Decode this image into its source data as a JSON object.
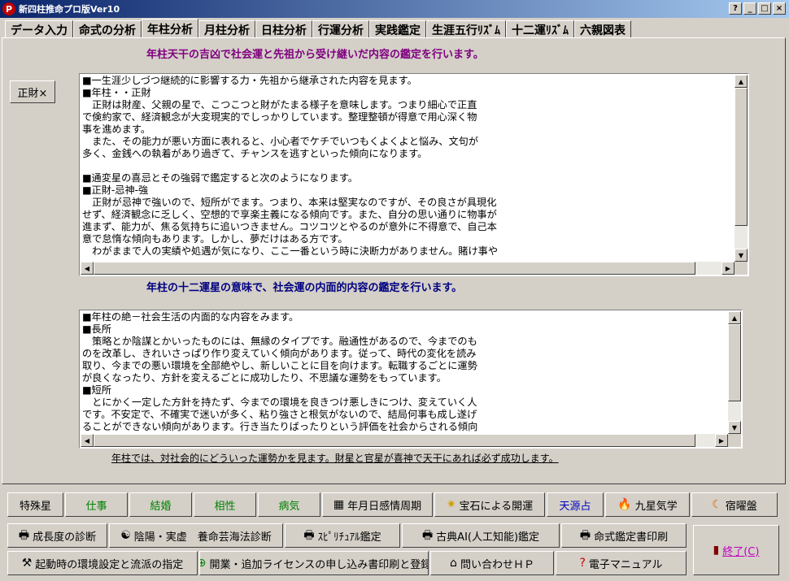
{
  "window": {
    "title": "新四柱推命プロ版Ver10",
    "buttons": [
      "?",
      "_",
      "□",
      "×"
    ]
  },
  "tabs": [
    "データ入力",
    "命式の分析",
    "年柱分析",
    "月柱分析",
    "日柱分析",
    "行運分析",
    "実践鑑定",
    "生涯五行ﾘｽﾞﾑ",
    "十二運ﾘｽﾞﾑ",
    "六親図表"
  ],
  "active_tab": "年柱分析",
  "headings": {
    "top": "年柱天干の吉凶で社会運と先祖から受け継いだ内容の鑑定を行います。",
    "middle": "年柱の十二運星の意味で、社会運の内面的内容の鑑定を行います。"
  },
  "side_button": "正財×",
  "text1": [
    "■一生涯少しづつ継続的に影響する力・先祖から継承された内容を見ます。",
    "■年柱・・正財",
    "　正財は財産、父親の星で、こつこつと財がたまる様子を意味します。つまり細心で正直",
    "で倹約家で、経済観念が大変現実的でしっかりしています。整理整頓が得意で用心深く物",
    "事を進めます。",
    "　また、その能力が悪い方面に表れると、小心者でケチでいつもくよくよと悩み、文句が",
    "多く、金銭への執着があり過ぎて、チャンスを逃すといった傾向になります。",
    "",
    "■通変星の喜忌とその強弱で鑑定すると次のようになります。",
    "■正財-忌神-強",
    "　正財が忌神で強いので、短所がでます。つまり、本来は堅実なのですが、その良さが具現化",
    "せず、経済観念に乏しく、空想的で享楽主義になる傾向です。また、自分の思い通りに物事が",
    "進まず、能力が、焦る気持ちに追いつきません。コツコツとやるのが意外に不得意で、自己本",
    "意で怠惰な傾向もあります。しかし、夢だけはある方です。",
    "　わがままで人の実績や処遇が気になり、ここ一番という時に決断力がありません。賭け事や"
  ],
  "text2": [
    "■年柱の絶－社会生活の内面的な内容をみます。",
    "■長所",
    "　策略とか陰謀とかいったものには、無縁のタイプです。融通性があるので、今までのも",
    "のを改革し、きれいさっぱり作り変えていく傾向があります。従って、時代の変化を読み",
    "取り、今までの悪い環境を全部絶やし、新しいことに目を向けます。転職するごとに運勢",
    "が良くなったり、方針を変えるごとに成功したり、不思議な運勢をもっています。",
    "■短所",
    "　とにかく一定した方針を持たず、今までの環境を良きつけ悪しきにつけ、変えていく人",
    "です。不安定で、不確実で迷いが多く、粘り強さと根気がないので、結局何事も成し遂げ",
    "ることができない傾向があります。行き当たりばったりという評価を社会からされる傾向"
  ],
  "footnote": "年柱では、対社会的にどういった運勢かを見ます。財星と官星が喜神で天干にあれば必ず成功します。",
  "row1": [
    "特殊星",
    "仕事",
    "結婚",
    "相性",
    "病気",
    "年月日感情周期",
    "宝石による開運",
    "天源占",
    "九星気学",
    "宿曜盤"
  ],
  "row2": [
    "成長度の診断",
    "陰陽・実虚　養命芸海法診断",
    "ｽﾋﾟﾘﾁｭｱﾙ鑑定",
    "古典AI(人工知能)鑑定",
    "命式鑑定書印刷"
  ],
  "row3": [
    "起動時の環境設定と流派の指定",
    "開業・追加ライセンスの申し込み書印刷と登録",
    "問い合わせＨＰ",
    "電子マニュアル"
  ],
  "exit_button": "終了(C)",
  "colors": {
    "title_bar": "#0a246a",
    "heading_top": "#800080",
    "heading_middle": "#000080",
    "green_text": "#008000",
    "blue_text": "#0000c0",
    "exit_text": "#c000c0"
  }
}
